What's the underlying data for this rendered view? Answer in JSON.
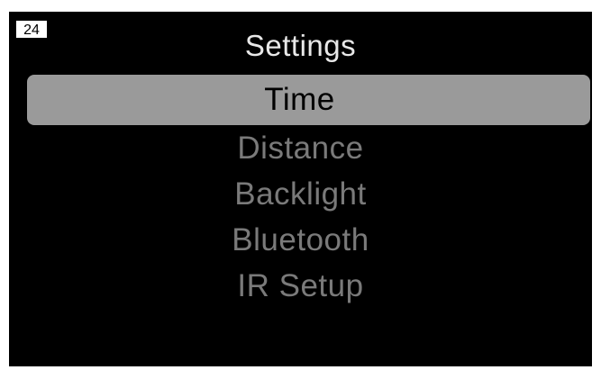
{
  "status": {
    "page_number": "24"
  },
  "header": {
    "title": "Settings"
  },
  "menu": {
    "selected_index": 0,
    "items": [
      {
        "label": "Time"
      },
      {
        "label": "Distance"
      },
      {
        "label": "Backlight"
      },
      {
        "label": "Bluetooth"
      },
      {
        "label": "IR Setup"
      }
    ]
  },
  "colors": {
    "background": "#000000",
    "title_text": "#e8e8e8",
    "selected_bg": "#9a9a9a",
    "selected_text": "#000000",
    "unselected_text": "#7a7a7a"
  }
}
